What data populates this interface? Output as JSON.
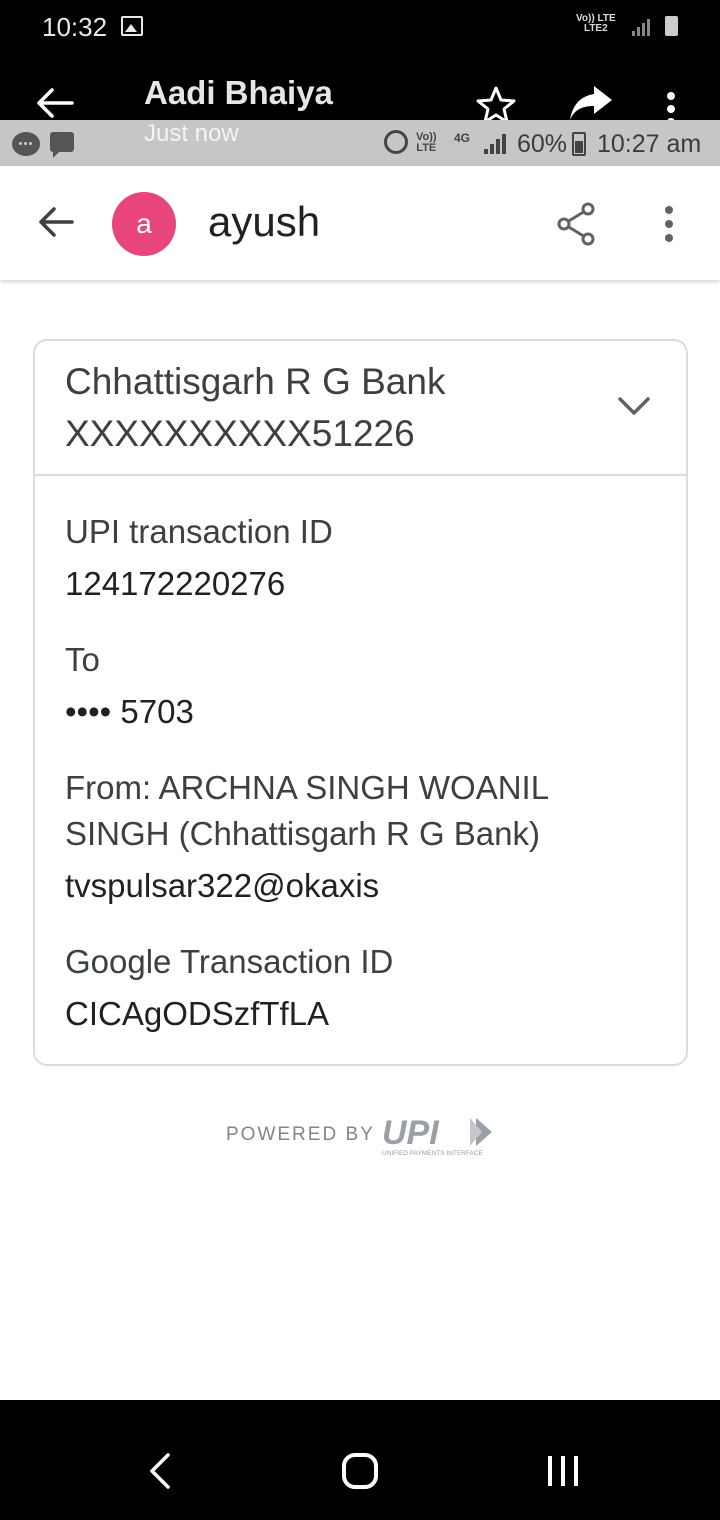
{
  "outer_status": {
    "time": "10:32",
    "network_top": "Vo))  LTE",
    "network_bottom": "LTE2"
  },
  "outer_header": {
    "title": "Aadi Bhaiya",
    "subtitle": "Just now"
  },
  "inner_status": {
    "volte_top": "Vo))",
    "volte_bottom": "LTE",
    "net_type": "4G",
    "battery": "60%",
    "time": "10:27 am"
  },
  "appbar": {
    "avatar_letter": "a",
    "title": "ayush"
  },
  "card": {
    "bank_name": "Chhattisgarh R G Bank",
    "account": "XXXXXXXXXX51226",
    "upi_label": "UPI transaction ID",
    "upi_value": "124172220276",
    "to_label": "To",
    "to_value": "•••• 5703",
    "from_line1": "From: ARCHNA SINGH WOANIL",
    "from_line2": "SINGH  (Chhattisgarh R G Bank)",
    "from_vpa": "tvspulsar322@okaxis",
    "google_label": "Google Transaction ID",
    "google_value": "CICAgODSzfTfLA"
  },
  "footer": {
    "powered_by": "POWERED BY",
    "upi_logo": "UPI",
    "upi_tagline": "UNIFIED PAYMENTS INTERFACE"
  },
  "colors": {
    "avatar": "#e8457a",
    "card_border": "#dadce0",
    "system_bar": "#000000",
    "inner_status_bar": "#c6c6c6"
  },
  "icons": [
    "back-arrow-icon",
    "star-icon",
    "forward-icon",
    "more-vert-icon",
    "share-icon",
    "chevron-down-icon",
    "alarm-icon",
    "signal-icon",
    "battery-icon",
    "chat-icon",
    "nav-back-icon",
    "nav-home-icon",
    "nav-recents-icon"
  ]
}
